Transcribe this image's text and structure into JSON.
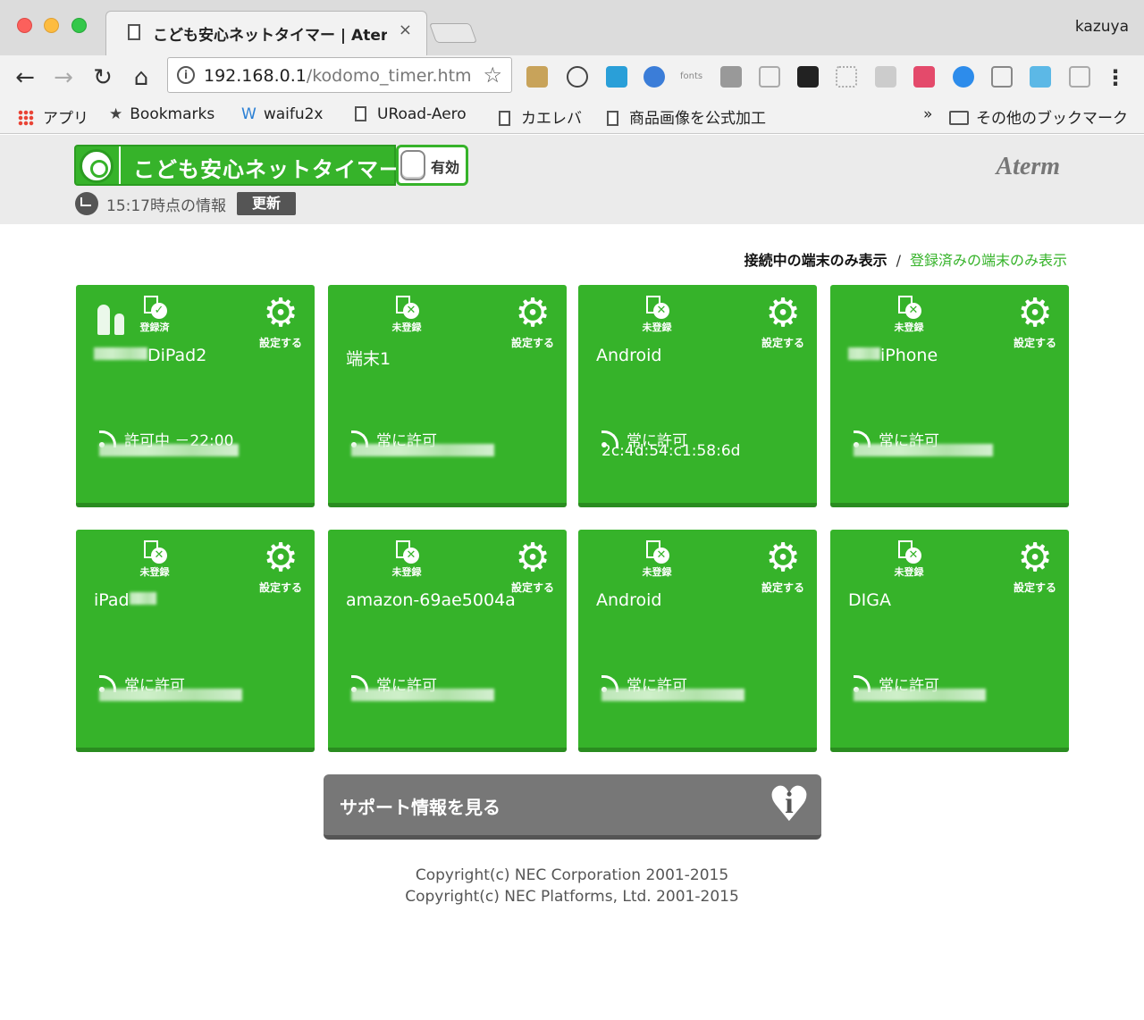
{
  "browser": {
    "tab_title": "こども安心ネットタイマー | Aterm",
    "tab_close": "×",
    "profile": "kazuya",
    "url_host": "192.168.0.1",
    "url_path": "/kodomo_timer.htm",
    "info_glyph": "i",
    "star": "☆",
    "back": "←",
    "forward": "→",
    "reload": "↻",
    "home": "⌂",
    "menu": "⋮",
    "bookmarks": [
      {
        "label": "アプリ",
        "icon": "apps-icon"
      },
      {
        "label": "Bookmarks",
        "icon": "star-icon"
      },
      {
        "label": "waifu2x",
        "icon": "w-icon"
      },
      {
        "label": "URoad-Aero",
        "icon": "page-icon"
      },
      {
        "label": "カエレバ",
        "icon": "page-icon"
      },
      {
        "label": "商品画像を公式加工",
        "icon": "page-icon"
      }
    ],
    "bookmarks_overflow": "»",
    "other_bookmarks": "その他のブックマーク",
    "bm_star_glyph": "★",
    "bm_w_glyph": "W",
    "ext_fonts_label": "fonts"
  },
  "header": {
    "title": "こども安心ネットタイマー",
    "toggle_label": "有効",
    "updated_text": "15:17時点の情報",
    "refresh_label": "更新",
    "brand": "Aterm"
  },
  "filter": {
    "connected_only": "接続中の端末のみ表示",
    "separator": "/",
    "registered_only": "登録済みの端末のみ表示"
  },
  "gear_glyph": "⚙",
  "devices": [
    {
      "status": "登録済",
      "status_glyph": "✓",
      "name": "DiPad2",
      "access": "許可中 －22:00",
      "mac": "",
      "settings": "設定する"
    },
    {
      "status": "未登録",
      "status_glyph": "✕",
      "name": "端末1",
      "access": "常に許可",
      "mac": "",
      "settings": "設定する"
    },
    {
      "status": "未登録",
      "status_glyph": "✕",
      "name": "Android",
      "access": "常に許可",
      "mac": "2c:4d:54:c1:58:6d",
      "settings": "設定する"
    },
    {
      "status": "未登録",
      "status_glyph": "✕",
      "name": "iPhone",
      "access": "常に許可",
      "mac": "",
      "settings": "設定する"
    },
    {
      "status": "未登録",
      "status_glyph": "✕",
      "name": "iPad",
      "access": "常に許可",
      "mac": "",
      "settings": "設定する"
    },
    {
      "status": "未登録",
      "status_glyph": "✕",
      "name": "amazon-69ae5004a",
      "access": "常に許可",
      "mac": "",
      "settings": "設定する"
    },
    {
      "status": "未登録",
      "status_glyph": "✕",
      "name": "Android",
      "access": "常に許可",
      "mac": "",
      "settings": "設定する"
    },
    {
      "status": "未登録",
      "status_glyph": "✕",
      "name": "DIGA",
      "access": "常に許可",
      "mac": "",
      "settings": "設定する"
    }
  ],
  "support": {
    "label": "サポート情報を見る",
    "heart_glyph": "♥",
    "info_glyph": "i"
  },
  "copyright": [
    "Copyright(c) NEC Corporation 2001-2015",
    "Copyright(c) NEC Platforms, Ltd. 2001-2015"
  ],
  "colors": {
    "card_green": "#36b32a",
    "link_green": "#36b32a",
    "support_gray": "#777777"
  }
}
